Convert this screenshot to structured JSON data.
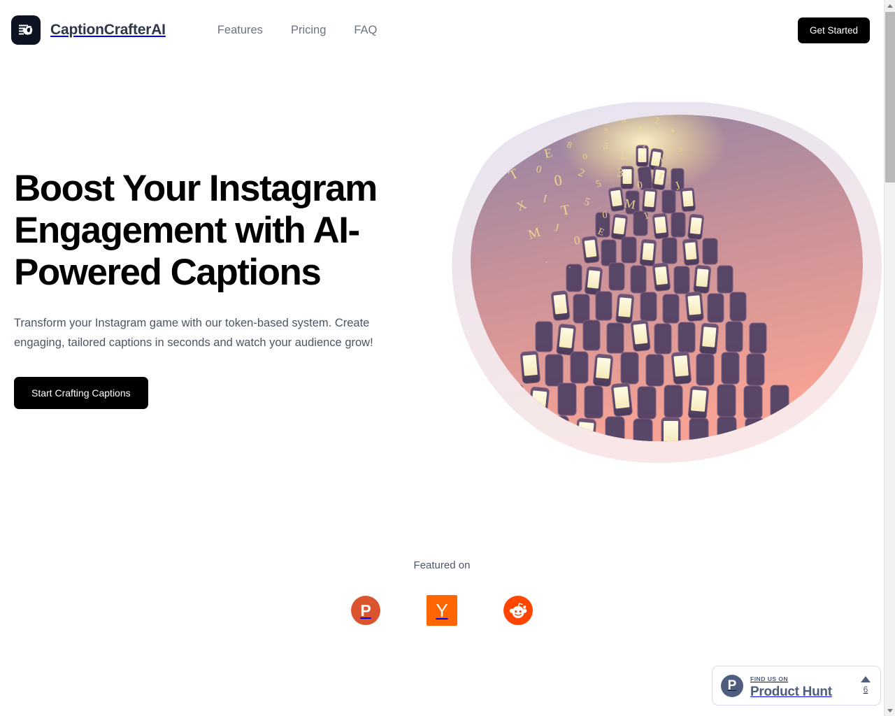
{
  "header": {
    "brand_name": "CaptionCrafterAI",
    "logo_icon": "caption-lines-c-icon",
    "nav": [
      {
        "label": "Features"
      },
      {
        "label": "Pricing"
      },
      {
        "label": "FAQ"
      }
    ],
    "cta_label": "Get Started"
  },
  "hero": {
    "title": "Boost Your Instagram Engagement with AI-Powered Captions",
    "subtitle": "Transform your Instagram game with our token-based system. Create engaging, tailored captions in seconds and watch your audience grow!",
    "cta_label": "Start Crafting Captions",
    "illustration_alt": "pyramid-of-smartphones-illustration"
  },
  "featured": {
    "label": "Featured on",
    "logos": [
      {
        "name": "product-hunt",
        "glyph": "P",
        "color": "#da552f"
      },
      {
        "name": "y-combinator",
        "glyph": "Y",
        "color": "#ff6600"
      },
      {
        "name": "reddit",
        "glyph": "",
        "color": "#ff4500"
      }
    ]
  },
  "product_hunt_badge": {
    "kicker": "FIND US ON",
    "title": "Product Hunt",
    "mark": "P",
    "upvote_count": "6",
    "color": "#4f5d7e"
  },
  "colors": {
    "accent_black": "#000000",
    "text_dark": "#2d3748",
    "text_muted": "#6b7280",
    "blob_outer": "#e6e3ef",
    "blob_inner_top": "#9a8aa8",
    "blob_inner_bottom": "#f4a79a"
  },
  "scrollbar": {
    "up_icon": "triangle-up-icon",
    "down_icon": "triangle-down-icon",
    "thumb": "scroll-thumb"
  }
}
